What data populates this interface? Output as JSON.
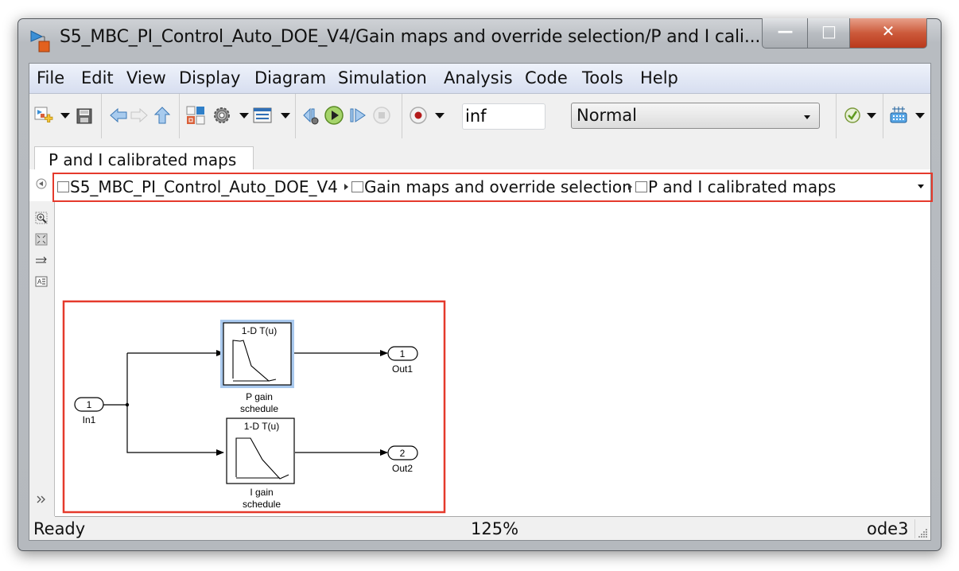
{
  "window": {
    "title": "S5_MBC_PI_Control_Auto_DOE_V4/Gain maps and override selection/P and I cali...",
    "controls": {
      "minimize": "minimize",
      "maximize": "maximize",
      "close": "close"
    }
  },
  "menu": [
    "File",
    "Edit",
    "View",
    "Display",
    "Diagram",
    "Simulation",
    "Analysis",
    "Code",
    "Tools",
    "Help"
  ],
  "toolbar": {
    "icons": [
      "new-model-icon",
      "save-icon",
      "back-arrow-icon",
      "forward-arrow-icon",
      "up-arrow-icon",
      "library-browser-icon",
      "model-config-icon",
      "model-explorer-icon",
      "step-back-icon",
      "run-icon",
      "step-forward-icon",
      "stop-icon",
      "record-icon",
      "model-advisor-icon",
      "build-icon"
    ],
    "stop_time": "inf",
    "sim_mode": "Normal"
  },
  "tab": {
    "label": "P and I calibrated maps"
  },
  "breadcrumb": [
    {
      "label": "S5_MBC_PI_Control_Auto_DOE_V4",
      "icon": "model-icon"
    },
    {
      "label": "Gain maps and override selection",
      "icon": "subsystem-icon"
    },
    {
      "label": "P and I calibrated maps",
      "icon": "subsystem-icon"
    }
  ],
  "palette": [
    "zoom-icon",
    "fit-to-view-icon",
    "route-lines-icon",
    "annotation-icon",
    "expand-icon"
  ],
  "diagram": {
    "inports": [
      {
        "number": "1",
        "name": "In1"
      }
    ],
    "outports": [
      {
        "number": "1",
        "name": "Out1"
      },
      {
        "number": "2",
        "name": "Out2"
      }
    ],
    "blocks": [
      {
        "type_label": "1-D T(u)",
        "name_line1": "P gain",
        "name_line2": "schedule",
        "selected": true
      },
      {
        "type_label": "1-D T(u)",
        "name_line1": "I gain",
        "name_line2": "schedule",
        "selected": false
      }
    ]
  },
  "status": {
    "left": "Ready",
    "zoom": "125%",
    "solver": "ode3"
  },
  "colors": {
    "highlight": "#e53a2c",
    "selection": "#a9c9ee"
  }
}
